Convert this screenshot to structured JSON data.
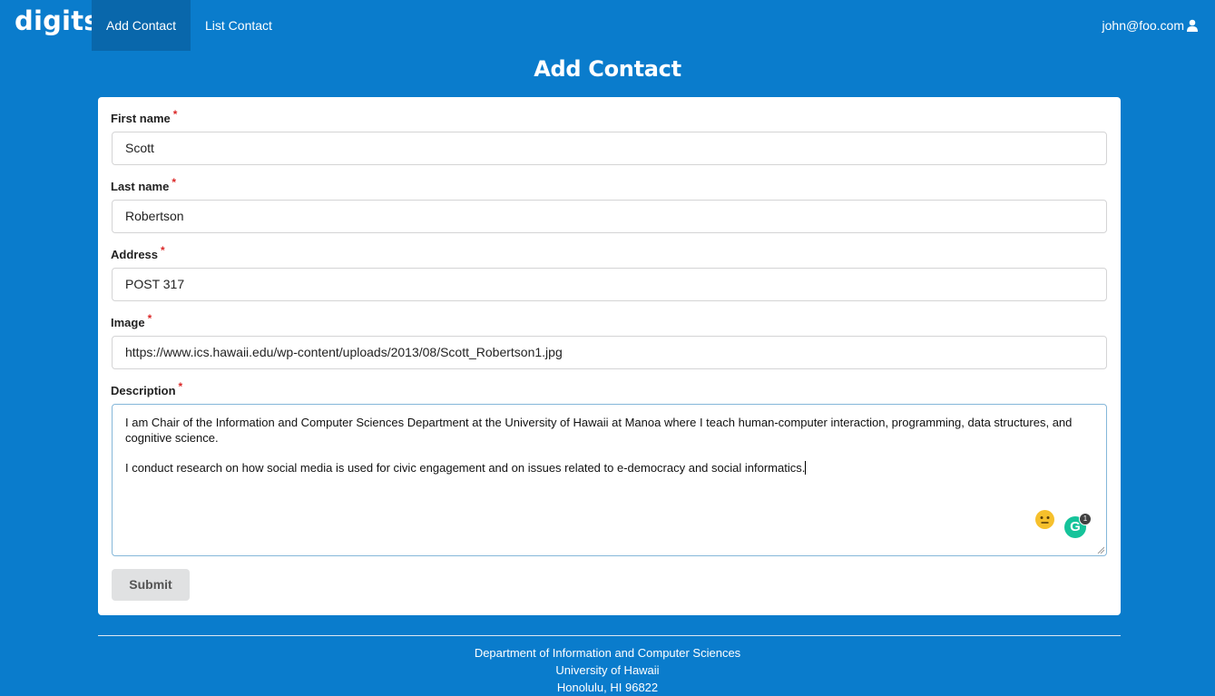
{
  "nav": {
    "brand": "digits",
    "items": [
      {
        "label": "Add Contact",
        "active": true
      },
      {
        "label": "List Contact",
        "active": false
      }
    ],
    "user": "john@foo.com",
    "user_icon": "user-icon"
  },
  "page": {
    "title": "Add Contact"
  },
  "form": {
    "required_marker": "*",
    "first_name": {
      "label": "First name",
      "value": "Scott"
    },
    "last_name": {
      "label": "Last name",
      "value": "Robertson"
    },
    "address": {
      "label": "Address",
      "value": "POST 317"
    },
    "image": {
      "label": "Image",
      "value": "https://www.ics.hawaii.edu/wp-content/uploads/2013/08/Scott_Robertson1.jpg"
    },
    "description": {
      "label": "Description",
      "paragraphs": [
        "I am Chair of the Information and Computer Sciences Department at the University of Hawaii at Manoa where I teach human-computer interaction, programming, data structures, and cognitive science.",
        "I conduct research on how social media is used for civic engagement and on issues related to e-democracy and social informatics."
      ]
    },
    "submit_label": "Submit",
    "grammarly": {
      "letter": "G",
      "count": "1"
    }
  },
  "footer": {
    "lines": [
      "Department of Information and Computer Sciences",
      "University of Hawaii",
      "Honolulu, HI 96822"
    ]
  },
  "colors": {
    "primary": "#0a7ccc",
    "active_nav": "#0967ab",
    "required": "#db2828"
  }
}
